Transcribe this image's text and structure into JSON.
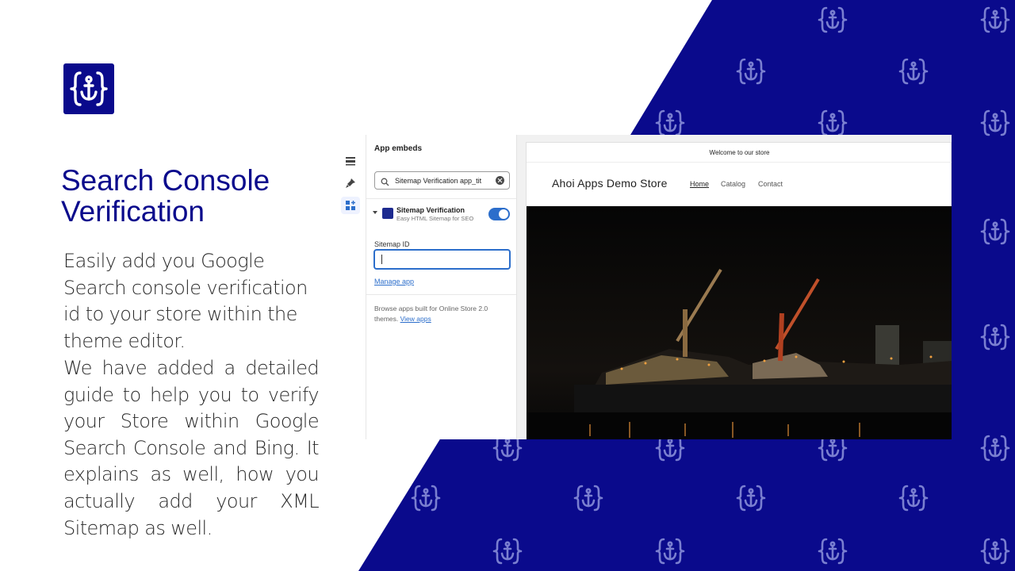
{
  "brand": {
    "logo_icon": "anchor-braces-icon",
    "accent": "#0a0a8c"
  },
  "headline": {
    "line1": "Search Console",
    "line2": "Verification"
  },
  "paragraphs": {
    "p1": "Easily add you Google Search console verification id to your store within the theme editor.",
    "p2": "We have added a detailed guide to help you to verify your Store within Google Search Console and Bing. It explains as well, how you actually add your XML Sitemap as well."
  },
  "editor": {
    "rail_icons": [
      "sections-icon",
      "brush-icon",
      "app-blocks-icon"
    ],
    "sidebar_title": "App embeds",
    "search": {
      "value": "Sitemap Verification app_tit",
      "icon": "search-icon"
    },
    "app": {
      "name": "Sitemap Verification",
      "subtitle": "Easy HTML Sitemap for SEO",
      "enabled": true
    },
    "field_label": "Sitemap ID",
    "field_value": "",
    "manage_link": "Manage app",
    "browse_text": "Browse apps built for Online Store 2.0 themes.",
    "browse_link": "View apps"
  },
  "preview": {
    "announcement": "Welcome to our store",
    "store_name": "Ahoi Apps Demo Store",
    "nav": [
      "Home",
      "Catalog",
      "Contact"
    ]
  }
}
